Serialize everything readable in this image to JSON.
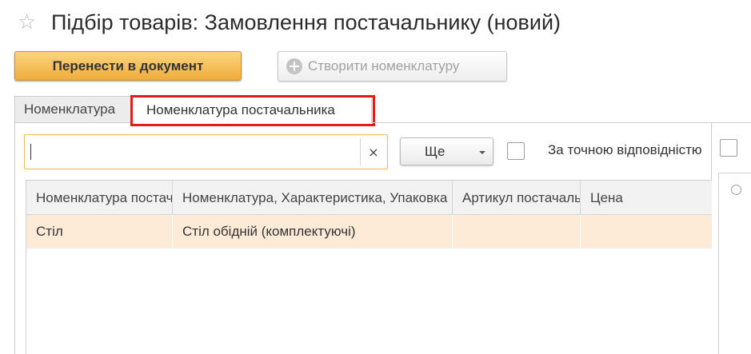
{
  "header": {
    "star_icon": "star-outline-icon",
    "title": "Підбір товарів: Замовлення постачальнику (новий)"
  },
  "toolbar": {
    "transfer_label": "Перенести в документ",
    "create_icon": "plus-circle-icon",
    "create_label": "Створити номенклатуру"
  },
  "tabs": [
    {
      "label": "Номенклатура",
      "active": false
    },
    {
      "label": "Номенклатура постачальника",
      "active": true,
      "highlighted": true
    }
  ],
  "colors": {
    "highlight": "#e51b1b",
    "primary_button": "#f0ad3c",
    "selected_row": "#fdebd8",
    "search_border": "#f0b94b"
  },
  "filter": {
    "search_value": "",
    "clear_symbol": "×",
    "more_label": "Ще",
    "exact_match_label": "За точною відповідністю",
    "exact_match_checked": false
  },
  "grid": {
    "columns": [
      "Номенклатура постачальника",
      "Номенклатура, Характеристика, Упаковка",
      "Артикул постачальника",
      "Цена"
    ],
    "rows": [
      [
        "Стіл",
        "Стіл обідній (комплектуючі)",
        "",
        ""
      ]
    ]
  }
}
